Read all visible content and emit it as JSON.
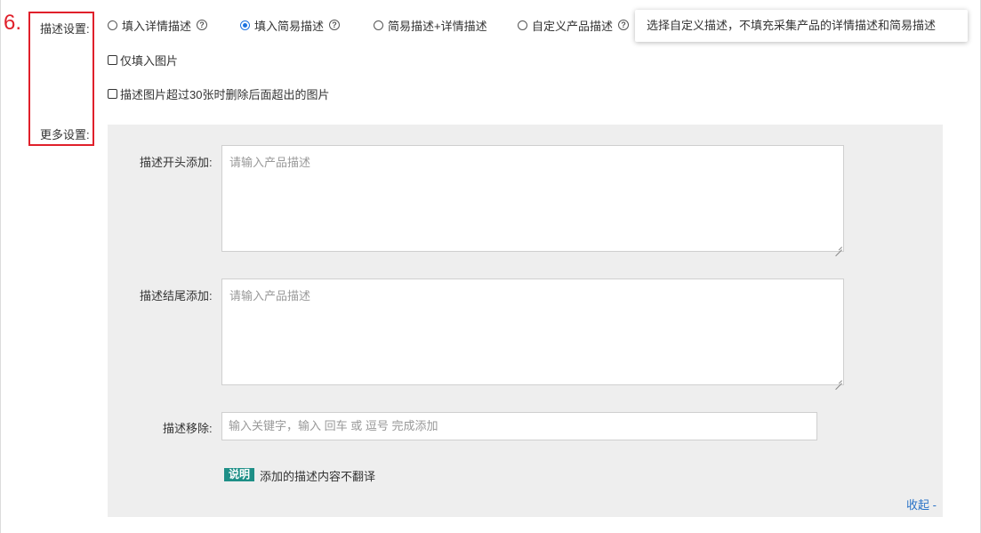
{
  "step_number": "6.",
  "description_settings": {
    "label": "描述设置:",
    "options": [
      {
        "label": "填入详情描述",
        "checked": false,
        "has_help": true
      },
      {
        "label": "填入简易描述",
        "checked": true,
        "has_help": true
      },
      {
        "label": "简易描述+详情描述",
        "checked": false,
        "has_help": false
      },
      {
        "label": "自定义产品描述",
        "checked": false,
        "has_help": true
      }
    ],
    "tooltip": "选择自定义描述，不填充采集产品的详情描述和简易描述",
    "only_images_label": "仅填入图片",
    "delete_images_label": "描述图片超过30张时删除后面超出的图片"
  },
  "more_settings": {
    "label": "更多设置:",
    "prefix_label": "描述开头添加:",
    "prefix_placeholder": "请输入产品描述",
    "suffix_label": "描述结尾添加:",
    "suffix_placeholder": "请输入产品描述",
    "remove_label": "描述移除:",
    "remove_placeholder": "输入关键字，输入 回车 或 逗号 完成添加",
    "note_badge": "说明",
    "note_text": "添加的描述内容不翻译",
    "collapse_link": "收起 -"
  },
  "icons": {
    "help": "question-circle-icon"
  },
  "colors": {
    "highlight": "#e0202b",
    "accent": "#1e73e0",
    "badge": "#1e8f87",
    "link": "#2a73c7",
    "panel": "#eeeeee"
  }
}
